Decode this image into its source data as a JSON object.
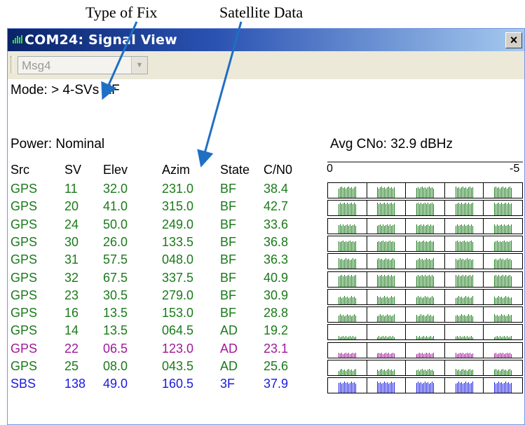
{
  "annotations": {
    "type_of_fix": "Type of Fix",
    "satellite_data": "Satellite Data"
  },
  "window": {
    "title": "COM24: Signal View",
    "close_label": "×"
  },
  "toolbar": {
    "message_select_value": "Msg4"
  },
  "status": {
    "mode": "Mode: > 4-SVs KF",
    "power": "Power: Nominal",
    "avg_cno": "Avg CNo: 32.9 dBHz"
  },
  "scale": {
    "min_label": "0",
    "max_label": "-5"
  },
  "table": {
    "headers": {
      "src": "Src",
      "sv": "SV",
      "elev": "Elev",
      "azim": "Azim",
      "state": "State",
      "cn0": "C/N0"
    },
    "rows": [
      {
        "src": "GPS",
        "sv": "11",
        "elev": "32.0",
        "azim": "231.0",
        "state": "BF",
        "cn0": "38.4",
        "color": "#1a7a1a"
      },
      {
        "src": "GPS",
        "sv": "20",
        "elev": "41.0",
        "azim": "315.0",
        "state": "BF",
        "cn0": "42.7",
        "color": "#1a7a1a"
      },
      {
        "src": "GPS",
        "sv": "24",
        "elev": "50.0",
        "azim": "249.0",
        "state": "BF",
        "cn0": "33.6",
        "color": "#1a7a1a"
      },
      {
        "src": "GPS",
        "sv": "30",
        "elev": "26.0",
        "azim": "133.5",
        "state": "BF",
        "cn0": "36.8",
        "color": "#1a7a1a"
      },
      {
        "src": "GPS",
        "sv": "31",
        "elev": "57.5",
        "azim": "048.0",
        "state": "BF",
        "cn0": "36.3",
        "color": "#1a7a1a"
      },
      {
        "src": "GPS",
        "sv": "32",
        "elev": "67.5",
        "azim": "337.5",
        "state": "BF",
        "cn0": "40.9",
        "color": "#1a7a1a"
      },
      {
        "src": "GPS",
        "sv": "23",
        "elev": "30.5",
        "azim": "279.0",
        "state": "BF",
        "cn0": "30.9",
        "color": "#1a7a1a"
      },
      {
        "src": "GPS",
        "sv": "16",
        "elev": "13.5",
        "azim": "153.0",
        "state": "BF",
        "cn0": "28.8",
        "color": "#1a7a1a"
      },
      {
        "src": "GPS",
        "sv": "14",
        "elev": "13.5",
        "azim": "064.5",
        "state": "AD",
        "cn0": "19.2",
        "color": "#1a7a1a"
      },
      {
        "src": "GPS",
        "sv": "22",
        "elev": "06.5",
        "azim": "123.0",
        "state": "AD",
        "cn0": "23.1",
        "color": "#a0189a"
      },
      {
        "src": "GPS",
        "sv": "25",
        "elev": "08.0",
        "azim": "043.5",
        "state": "AD",
        "cn0": "25.6",
        "color": "#1a7a1a"
      },
      {
        "src": "SBS",
        "sv": "138",
        "elev": "49.0",
        "azim": "160.5",
        "state": "3F",
        "cn0": "37.9",
        "color": "#1a1ae0"
      }
    ]
  },
  "colors": {
    "gps_tracked": "#1a7a1a",
    "gps_marginal": "#a0189a",
    "sbas": "#1a1ae0",
    "annotation_arrow": "#1f6fc4"
  },
  "icons": {
    "app": "signal-bars-icon",
    "close": "close-icon",
    "dropdown": "chevron-down-icon"
  }
}
